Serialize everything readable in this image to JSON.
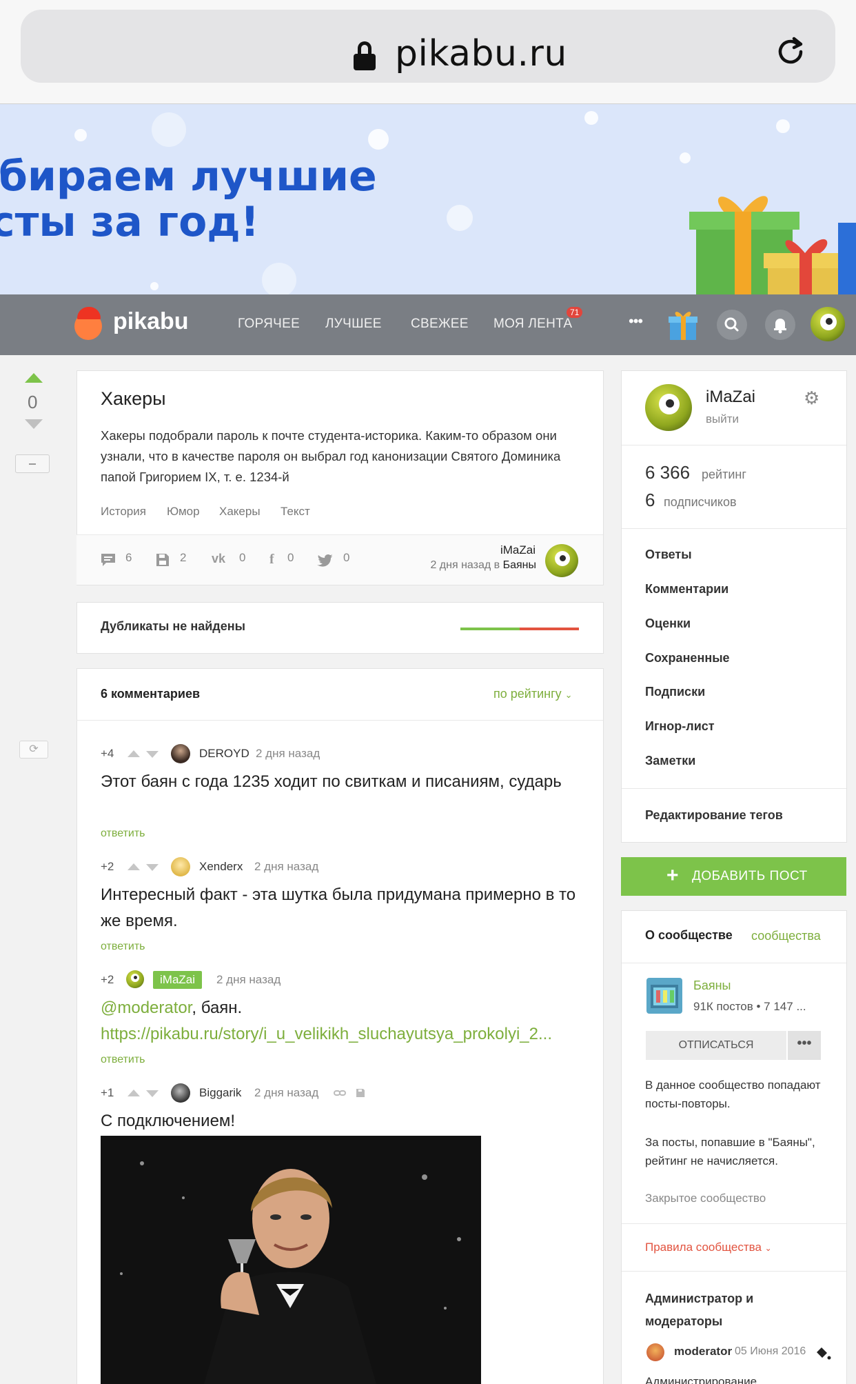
{
  "browser": {
    "url": "pikabu.ru"
  },
  "banner": {
    "line1": "бираем лучшие",
    "line2": "сты за год!"
  },
  "nav": {
    "logo": "pikabu",
    "items": [
      "ГОРЯЧЕЕ",
      "ЛУЧШЕЕ",
      "СВЕЖЕЕ",
      "МОЯ ЛЕНТА"
    ],
    "feed_badge": "71",
    "more": "•••"
  },
  "post": {
    "score": "0",
    "title": "Хакеры",
    "body": "Хакеры подобрали пароль к почте студента-историка. Каким-то образом они узнали, что в качестве пароля он выбрал год канонизации Святого Доминика папой Григорием IX, т. е. 1234-й",
    "tags": [
      "История",
      "Юмор",
      "Хакеры",
      "Текст"
    ],
    "stats": {
      "comments": "6",
      "saves": "2",
      "vk": "0",
      "fb": "0",
      "twitter": "0"
    },
    "author": "iMaZai",
    "time": "2 дня назад в",
    "community": "Баяны"
  },
  "duplicates": {
    "label": "Дубликаты не найдены"
  },
  "comments": {
    "count_label": "6 комментариев",
    "sort_label": "по рейтингу",
    "reply_label": "ответить",
    "items": [
      {
        "score": "+4",
        "user": "DEROYD",
        "time": "2 дня назад",
        "text": "Этот баян с года 1235 ходит по свиткам и писаниям, сударь"
      },
      {
        "score": "+2",
        "user": "Xenderx",
        "time": "2 дня назад",
        "text": "Интересный факт - эта шутка была придумана примерно в то же время."
      },
      {
        "score": "+2",
        "user": "iMaZai",
        "time": "2 дня назад",
        "mention": "@moderator",
        "text": ", баян.",
        "link": "https://pikabu.ru/story/i_u_velikikh_sluchayutsya_prokolyi_2..."
      },
      {
        "score": "+1",
        "user": "Biggarik",
        "time": "2 дня назад",
        "text": "С подключением!"
      }
    ]
  },
  "sidebar": {
    "username": "iMaZai",
    "logout": "выйти",
    "rating_value": "6 366",
    "rating_label": "рейтинг",
    "subs_value": "6",
    "subs_label": "подписчиков",
    "links": [
      "Ответы",
      "Комментарии",
      "Оценки",
      "Сохраненные",
      "Подписки",
      "Игнор-лист",
      "Заметки"
    ],
    "edit_tags": "Редактирование тегов",
    "add_post": "ДОБАВИТЬ ПОСТ",
    "about_title": "О сообществе",
    "about_tab": "сообщества",
    "community_name": "Баяны",
    "community_stats": "91К постов • 7 147 ...",
    "unsubscribe": "ОТПИСАТЬСЯ",
    "more": "•••",
    "desc1": "В данное сообщество попадают посты-повторы.",
    "desc2": "За посты, попавшие в \"Баяны\", рейтинг не начисляется.",
    "closed": "Закрытое сообщество",
    "rules": "Правила сообщества",
    "admins_title": "Администратор и модераторы",
    "moderator": "moderator",
    "moderator_date": "05 Июня 2016",
    "admin_line": "Администрирование"
  },
  "colors": {
    "green": "#7dc34a",
    "nav": "#7a7e84",
    "red": "#e2533f"
  }
}
